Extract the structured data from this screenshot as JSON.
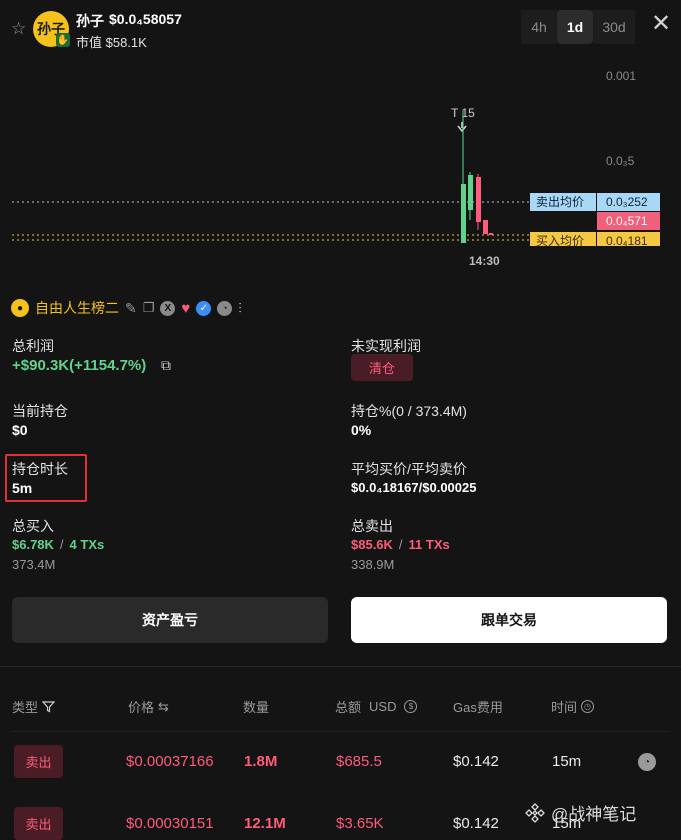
{
  "header": {
    "token_name": "孙子",
    "token_price": "$0.0₄58057",
    "avatar_text": "孙子",
    "market_cap": "市值 $58.1K",
    "timeframes": [
      {
        "label": "4h",
        "active": false
      },
      {
        "label": "1d",
        "active": true
      },
      {
        "label": "30d",
        "active": false
      }
    ]
  },
  "chart": {
    "price_ticks": [
      "0.001",
      "0.0₃5"
    ],
    "marker_label": "T 15",
    "time_label": "14:30",
    "sell_avg_label": "卖出均价",
    "sell_avg_value": "0.0₃252",
    "current_value": "0.0₄571",
    "buy_avg_label": "买入均价",
    "buy_avg_value": "0.0₄181",
    "colors": {
      "up": "#5fd38b",
      "down": "#ff5c7c",
      "sell_avg": "#a8d8f5",
      "buy_avg": "#f5c842"
    }
  },
  "wallet": {
    "name": "自由人生榜二"
  },
  "stats": {
    "total_profit_label": "总利润",
    "total_profit_value": "+$90.3K(+1154.7%)",
    "unrealized_label": "未实现利润",
    "clear_label": "清仓",
    "holding_label": "当前持仓",
    "holding_value": "$0",
    "holding_pct_label": "持仓%(0 / 373.4M)",
    "holding_pct_value": "0%",
    "duration_label": "持仓时长",
    "duration_value": "5m",
    "avg_label": "平均买价/平均卖价",
    "avg_value": "$0.0₄18167/$0.00025",
    "total_buy_label": "总买入",
    "total_buy_amount": "$6.78K",
    "total_buy_sep": "/",
    "total_buy_txs": "4 TXs",
    "total_buy_qty": "373.4M",
    "total_sell_label": "总卖出",
    "total_sell_amount": "$85.6K",
    "total_sell_sep": "/",
    "total_sell_txs": "11 TXs",
    "total_sell_qty": "338.9M"
  },
  "actions": {
    "pnl_button": "资产盈亏",
    "copy_button": "跟单交易"
  },
  "table": {
    "headers": {
      "type": "类型",
      "price": "价格",
      "qty": "数量",
      "total": "总额",
      "usd": "USD",
      "gas": "Gas费用",
      "time": "时间"
    },
    "rows": [
      {
        "type": "卖出",
        "price": "$0.00037166",
        "qty": "1.8M",
        "total": "$685.5",
        "gas": "$0.142",
        "time": "15m"
      },
      {
        "type": "卖出",
        "price": "$0.00030151",
        "qty": "12.1M",
        "total": "$3.65K",
        "gas": "$0.142",
        "time": "15m"
      }
    ]
  },
  "watermark": "@战神笔记"
}
